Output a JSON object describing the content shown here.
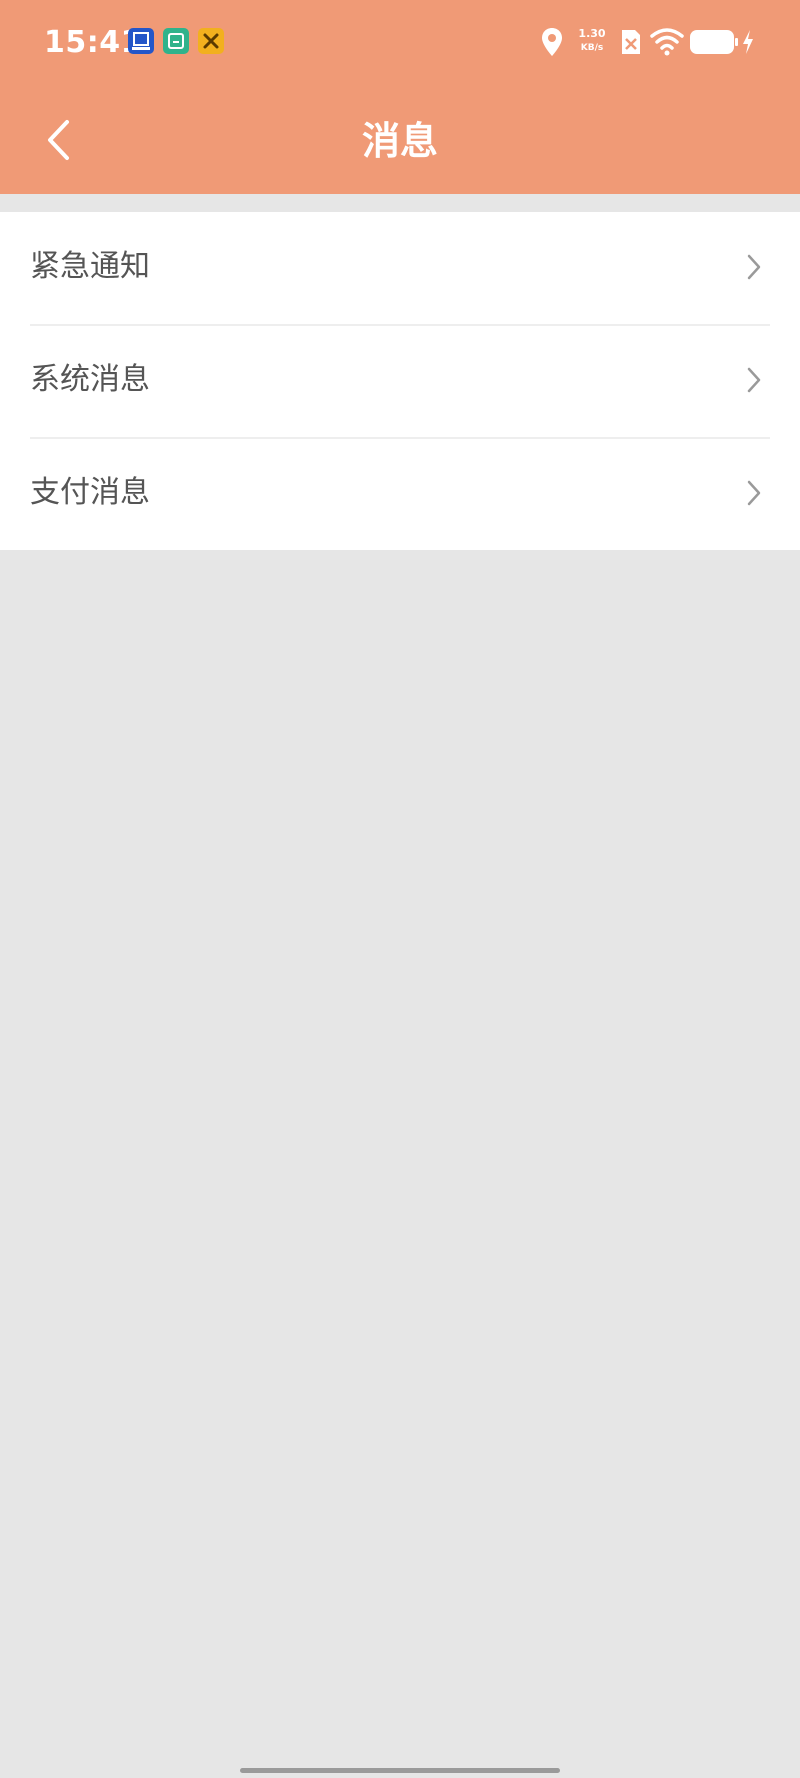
{
  "colors": {
    "header_bg": "#f09a76",
    "page_bg": "#e6e6e6",
    "list_bg": "#ffffff",
    "label_text": "#555555",
    "chevron": "#9a9a9a"
  },
  "status_bar": {
    "time": "15:41",
    "notification_icons": [
      "app-notification-blue-icon",
      "app-notification-green-icon",
      "app-notification-yellow-icon"
    ],
    "network_speed_value": "1.30",
    "network_speed_unit": "KB/s",
    "icons": [
      "location-icon",
      "sim-icon",
      "wifi-icon",
      "battery-icon",
      "charging-icon"
    ]
  },
  "header": {
    "back_icon": "chevron-left-icon",
    "title": "消息"
  },
  "messages": {
    "items": [
      {
        "label": "紧急通知",
        "icon": "chevron-right-icon"
      },
      {
        "label": "系统消息",
        "icon": "chevron-right-icon"
      },
      {
        "label": "支付消息",
        "icon": "chevron-right-icon"
      }
    ]
  }
}
